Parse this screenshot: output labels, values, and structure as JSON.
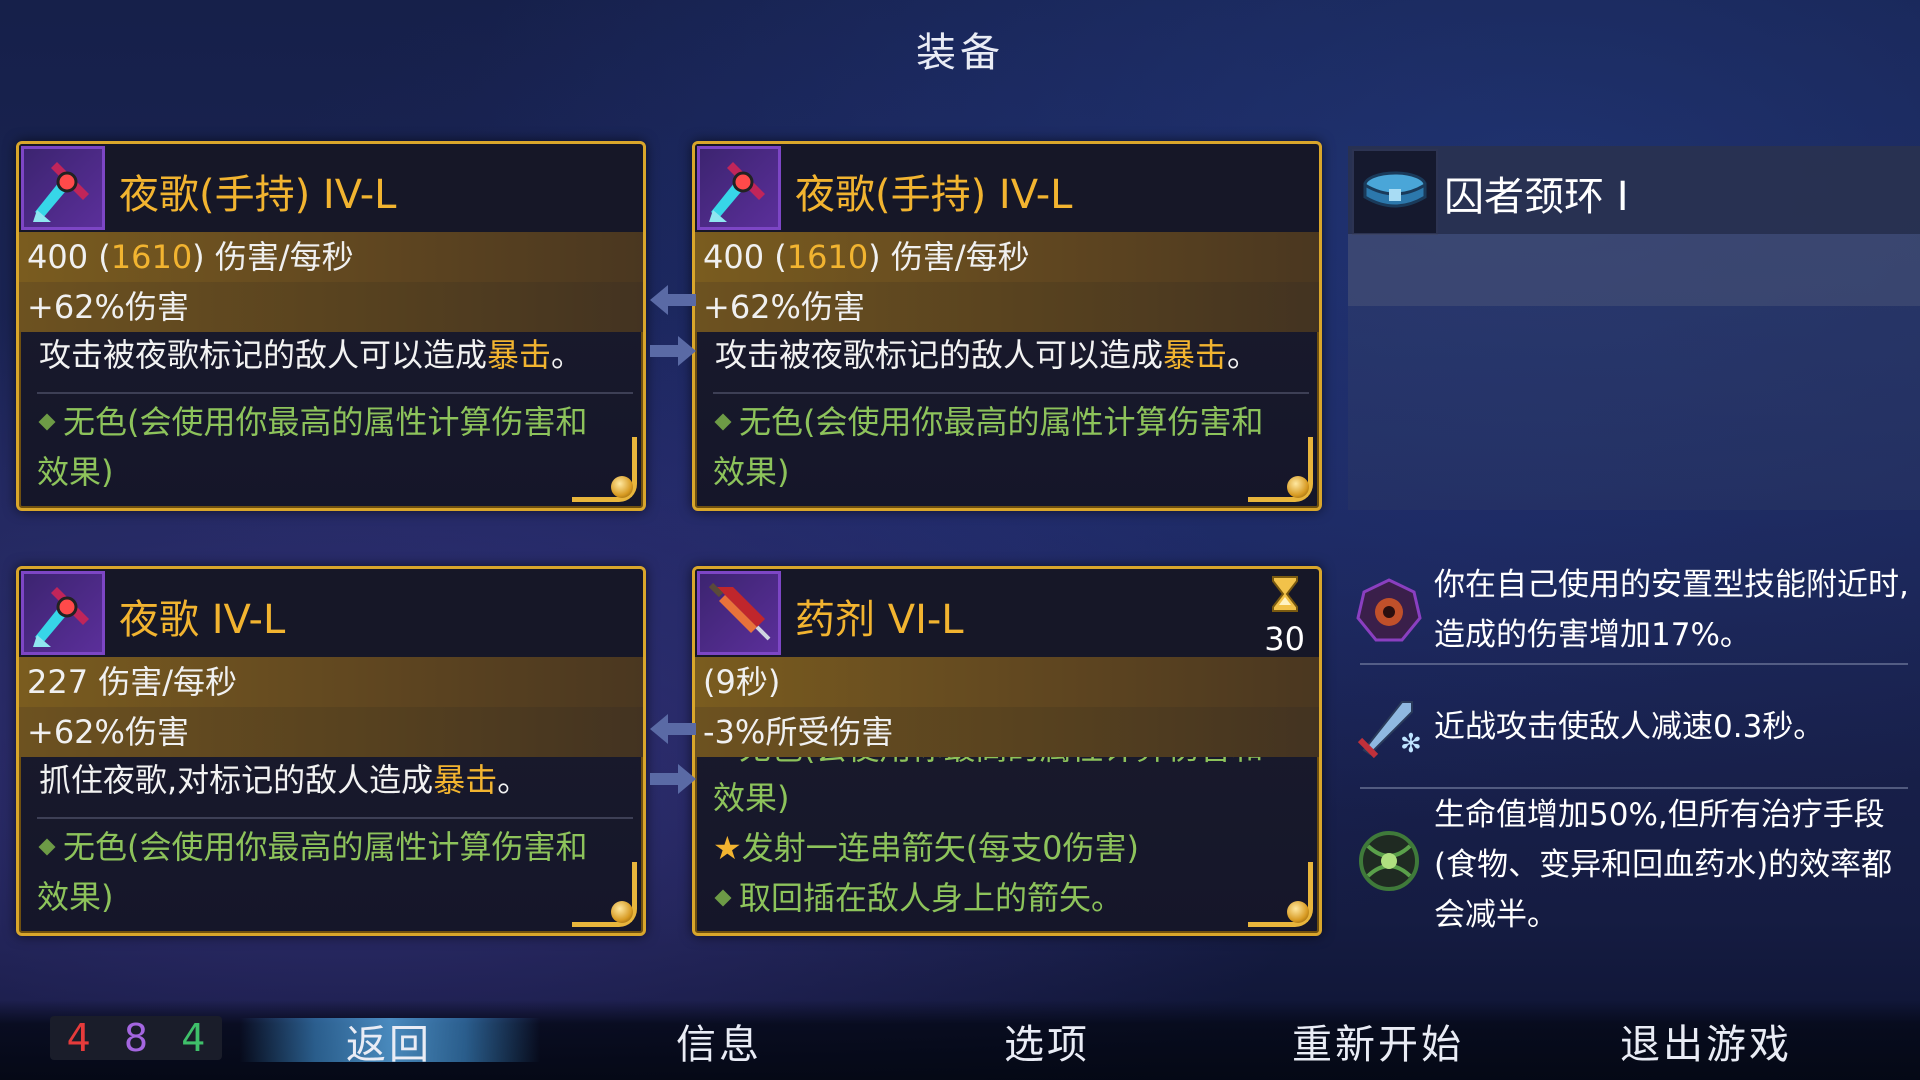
{
  "title": "装备",
  "weapons": [
    {
      "name": "夜歌(手持) IV-L",
      "icon": "crossbow-gem-icon",
      "dps_base": "400",
      "dps_open": "(",
      "dps_total": "1610",
      "dps_unit": ") 伤害/每秒",
      "bonus": "+62%伤害",
      "desc_main": "攻击被夜歌标记的敌人可以造成",
      "desc_hl": "暴击",
      "desc_end": "。",
      "trait_line1": "无色(会使用你最高的属性计算伤害和",
      "trait_line2": "效果)"
    },
    {
      "name": "夜歌(手持) IV-L",
      "icon": "crossbow-gem-icon",
      "dps_base": "400",
      "dps_open": "(",
      "dps_total": "1610",
      "dps_unit": ") 伤害/每秒",
      "bonus": "+62%伤害",
      "desc_main": "攻击被夜歌标记的敌人可以造成",
      "desc_hl": "暴击",
      "desc_end": "。",
      "trait_line1": "无色(会使用你最高的属性计算伤害和",
      "trait_line2": "效果)"
    },
    {
      "name": "夜歌 IV-L",
      "icon": "crossbow-gem-icon",
      "dps": "227 伤害/每秒",
      "bonus": "+62%伤害",
      "desc_main": "抓住夜歌,对标记的敌人造成",
      "desc_hl": "暴击",
      "desc_end": "。",
      "trait_line1": "无色(会使用你最高的属性计算伤害和",
      "trait_line2": "效果)"
    },
    {
      "name": "药剂 VI-L",
      "icon": "potion-syringe-icon",
      "timer_icon": "hourglass-icon",
      "cooldown": "30",
      "duration": "(9秒)",
      "bonus": "-3%所受伤害",
      "trait_cut": "无色(会使用你最高的属性计算伤害和",
      "trait_cut2": "效果)",
      "star_line": "发射一连串箭矢(每支0伤害)",
      "diamond_line": "取回插在敌人身上的箭矢。"
    }
  ],
  "amulet": {
    "name": "囚者颈环 I",
    "icon": "amulet-icon"
  },
  "mutations": [
    {
      "icon": "tactician-eye-icon",
      "text": "你在自己使用的安置型技能附近时,造成的伤害增加17%。"
    },
    {
      "icon": "frost-blade-icon",
      "text": "近战攻击使敌人减速0.3秒。"
    },
    {
      "icon": "vine-skull-icon",
      "text": "生命值增加50%,但所有治疗手段(食物、变异和回血药水)的效率都会减半。"
    }
  ],
  "stats": {
    "brutality": "4",
    "tactics": "8",
    "survival": "4"
  },
  "menu": {
    "back": "返回",
    "info": "信息",
    "options": "选项",
    "restart": "重新开始",
    "quit": "退出游戏"
  },
  "colors": {
    "gold": "#f2b430",
    "trait_green": "#8dc35b",
    "border": "#d9a62b"
  }
}
